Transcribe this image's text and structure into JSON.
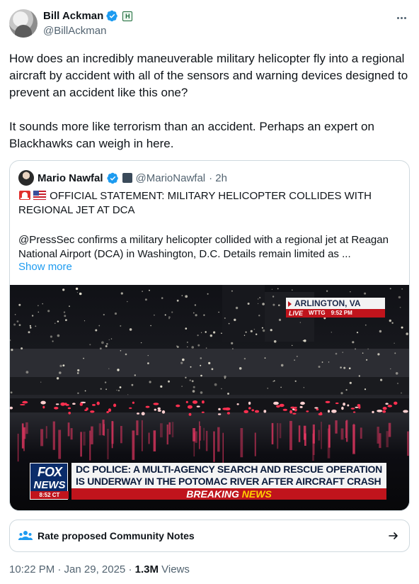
{
  "tweet": {
    "display_name": "Bill Ackman",
    "handle": "@BillAckman",
    "affiliate_badge": "H",
    "text": "How does an incredibly maneuverable military helicopter fly into a regional aircraft by accident with all of the sensors and warning devices designed to prevent an accident like this one?\n\nIt sounds more like terrorism than an accident. Perhaps an expert on Blackhawks can weigh in here.",
    "timestamp": "10:22 PM · Jan 29, 2025 · ",
    "views_count": "1.3M",
    "views_label": " Views"
  },
  "quote": {
    "display_name": "Mario Nawfal",
    "handle": "@MarioNawfal",
    "time": "· 2h",
    "headline": "OFFICIAL STATEMENT: MILITARY HELICOPTER COLLIDES WITH REGIONAL JET AT DCA",
    "body": "@PressSec confirms a military helicopter collided with a regional jet at Reagan National Airport (DCA) in Washington, D.C. Details remain limited as ...",
    "show_more": "Show more"
  },
  "video": {
    "location": "ARLINGTON, VA",
    "live": "LIVE",
    "station": "WTTG",
    "time": "9:52 PM",
    "network_top": "FOX",
    "network_bottom": "NEWS",
    "clock": "8:52 CT",
    "chyron_line1": "DC POLICE: A MULTI-AGENCY SEARCH AND RESCUE OPERATION",
    "chyron_line2": "IS UNDERWAY IN THE POTOMAC RIVER AFTER AIRCRAFT CRASH",
    "breaking_1": "BREAKING ",
    "breaking_2": "NEWS"
  },
  "community_notes": {
    "label": "Rate proposed Community Notes"
  },
  "colors": {
    "verified_blue": "#1d9bf0",
    "link_blue": "#1d9bf0",
    "secondary_text": "#536471",
    "border": "#cfd9de",
    "breaking_red": "#c0141c"
  }
}
